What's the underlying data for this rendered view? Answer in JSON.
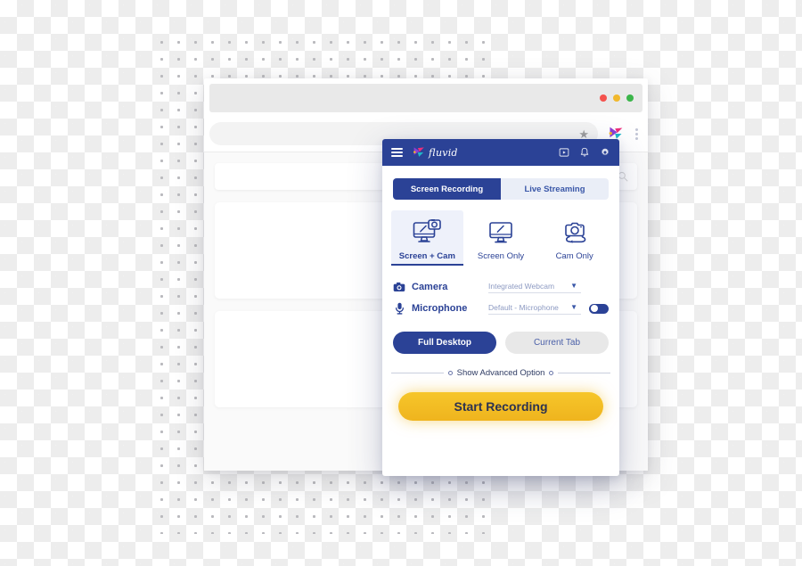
{
  "browser": {
    "traffic_lights": [
      "red",
      "amber",
      "green"
    ],
    "omnibox": {
      "value": "",
      "placeholder": ""
    },
    "star_icon": "star-icon",
    "extension_icon": "fluvid-extension-icon",
    "menu_icon": "kebab-menu-icon",
    "page": {
      "search": {
        "value": "",
        "placeholder": "",
        "icon": "search-icon"
      },
      "cards": [
        "content-card-1",
        "content-card-2"
      ]
    }
  },
  "popup": {
    "header": {
      "menu_icon": "hamburger-menu-icon",
      "brand_name": "fluvid",
      "icons": [
        {
          "name": "video-library-icon"
        },
        {
          "name": "notification-bell-icon"
        },
        {
          "name": "settings-gear-icon"
        }
      ]
    },
    "tabs": [
      {
        "label": "Screen Recording",
        "active": true
      },
      {
        "label": "Live Streaming",
        "active": false
      }
    ],
    "modes": [
      {
        "label": "Screen + Cam",
        "icon": "monitor-with-camera-icon",
        "active": true
      },
      {
        "label": "Screen Only",
        "icon": "monitor-icon",
        "active": false
      },
      {
        "label": "Cam Only",
        "icon": "webcam-laptop-icon",
        "active": false
      }
    ],
    "devices": [
      {
        "label": "Camera",
        "icon": "camera-icon",
        "value": "Integrated Webcam",
        "caret": "chevron-down-icon",
        "has_toggle": false
      },
      {
        "label": "Microphone",
        "icon": "microphone-icon",
        "value": "Default - Microphone",
        "caret": "chevron-down-icon",
        "has_toggle": true,
        "toggle_on": true
      }
    ],
    "scope_buttons": [
      {
        "label": "Full Desktop",
        "primary": true
      },
      {
        "label": "Current Tab",
        "primary": false
      }
    ],
    "advanced_label": "Show Advanced Option",
    "start_button": "Start Recording"
  },
  "colors": {
    "brand_blue": "#2b4296",
    "accent_yellow": "#f0b91e",
    "tab_inactive_bg": "#eaeef7",
    "mode_active_bg": "#eef1fa"
  }
}
